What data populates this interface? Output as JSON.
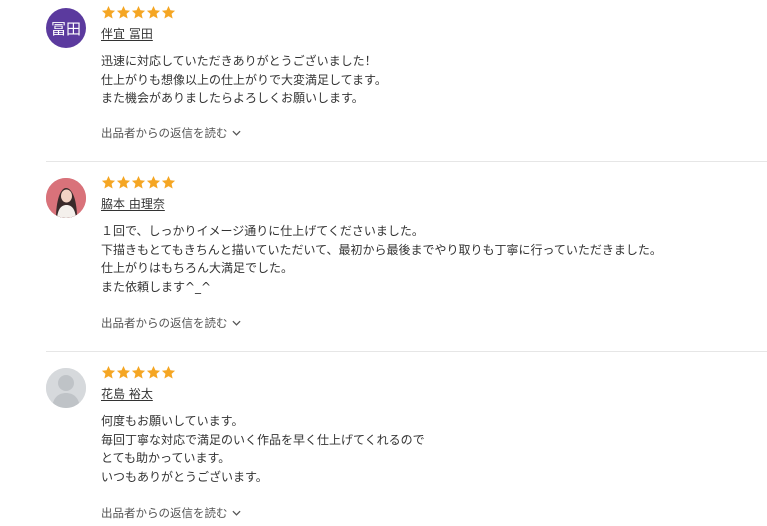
{
  "colors": {
    "star": "#f5a623",
    "avatar_initials_bg": "#5b3a9e",
    "divider": "#e6e6e6"
  },
  "reviews": [
    {
      "avatar": {
        "type": "initials",
        "text": "冨田"
      },
      "rating": 5,
      "reviewer": "伴宜 冨田",
      "comment": [
        "迅速に対応していただきありがとうございました！",
        "仕上がりも想像以上の仕上がりで大変満足してます。",
        "また機会がありましたらよろしくお願いします。"
      ],
      "reply_toggle": "出品者からの返信を読む"
    },
    {
      "avatar": {
        "type": "photo",
        "icon": "user-photo-icon"
      },
      "rating": 5,
      "reviewer": "脇本 由理奈",
      "comment": [
        "１回で、しっかりイメージ通りに仕上げてくださいました。",
        "下描きもとてもきちんと描いていただいて、最初から最後までやり取りも丁寧に行っていただきました。",
        "仕上がりはもちろん大満足でした。",
        "また依頼します^_^"
      ],
      "reply_toggle": "出品者からの返信を読む"
    },
    {
      "avatar": {
        "type": "default",
        "icon": "default-user-icon"
      },
      "rating": 5,
      "reviewer": "花島 裕太",
      "comment": [
        "何度もお願いしています。",
        "毎回丁寧な対応で満足のいく作品を早く仕上げてくれるので",
        "とても助かっています。",
        "いつもありがとうございます。"
      ],
      "reply_toggle": "出品者からの返信を読む"
    }
  ]
}
